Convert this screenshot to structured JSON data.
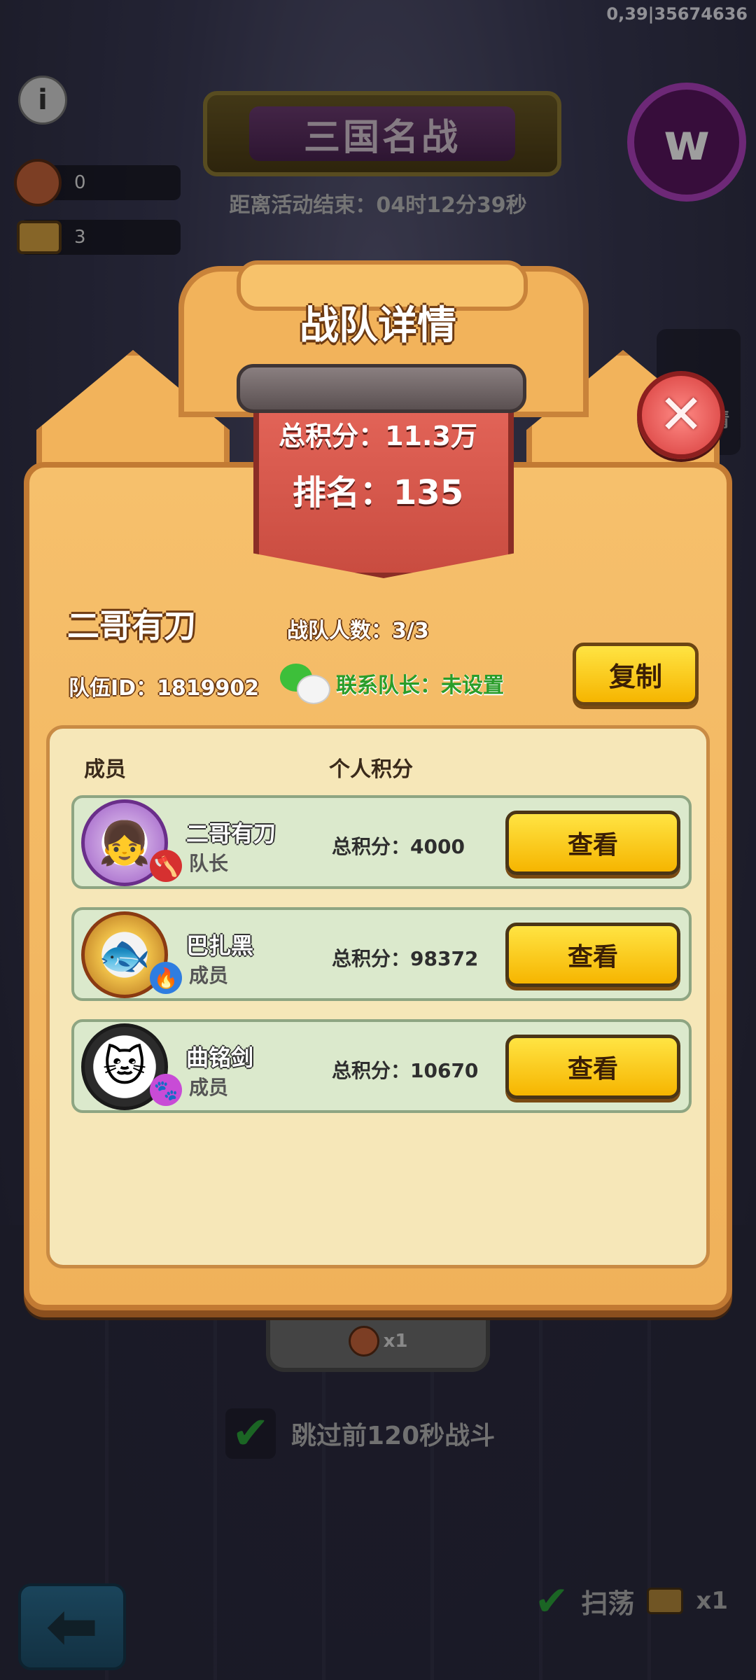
{
  "status_code": "0,39|35674636",
  "resources": [
    {
      "icon": "meat-food-icon",
      "value": "0"
    },
    {
      "icon": "ticket-icon",
      "value": "3"
    }
  ],
  "event": {
    "title": "三国名战",
    "countdown": "距离活动结束：04时12分39秒"
  },
  "side_label": "情",
  "battle": {
    "cost": "x1"
  },
  "skip": {
    "label": "跳过前120秒战斗",
    "checked": true
  },
  "sweep": {
    "label": "扫荡",
    "cost": "x1",
    "checked": true
  },
  "modal": {
    "title": "战队详情",
    "total_score": "总积分：11.3万",
    "rank": "排名：135",
    "team_name": "二哥有刀",
    "team_count": "战队人数：3/3",
    "team_id": "队伍ID：1819902",
    "contact": "联系队长：未设置",
    "copy_label": "复制",
    "col_member": "成员",
    "col_score": "个人积分",
    "members": [
      {
        "name": "二哥有刀",
        "role": "队长",
        "score": "总积分：4000",
        "button": "查看",
        "avatar_icon": "warrior-girl-avatar-icon",
        "badge_icon": "axe-badge-icon",
        "avatar_color": "#b15bd0",
        "badge_color": "#d63030"
      },
      {
        "name": "巴扎黑",
        "role": "成员",
        "score": "总积分：98372",
        "button": "查看",
        "avatar_icon": "fish-king-avatar-icon",
        "badge_icon": "flame-badge-icon",
        "avatar_color": "#e0a32a",
        "badge_color": "#2f7de0"
      },
      {
        "name": "曲铭剑",
        "role": "成员",
        "score": "总积分：10670",
        "button": "查看",
        "avatar_icon": "lucky-cat-avatar-icon",
        "badge_icon": "paw-badge-icon",
        "avatar_color": "#2b2b2b",
        "badge_color": "#c84bd6"
      }
    ]
  }
}
